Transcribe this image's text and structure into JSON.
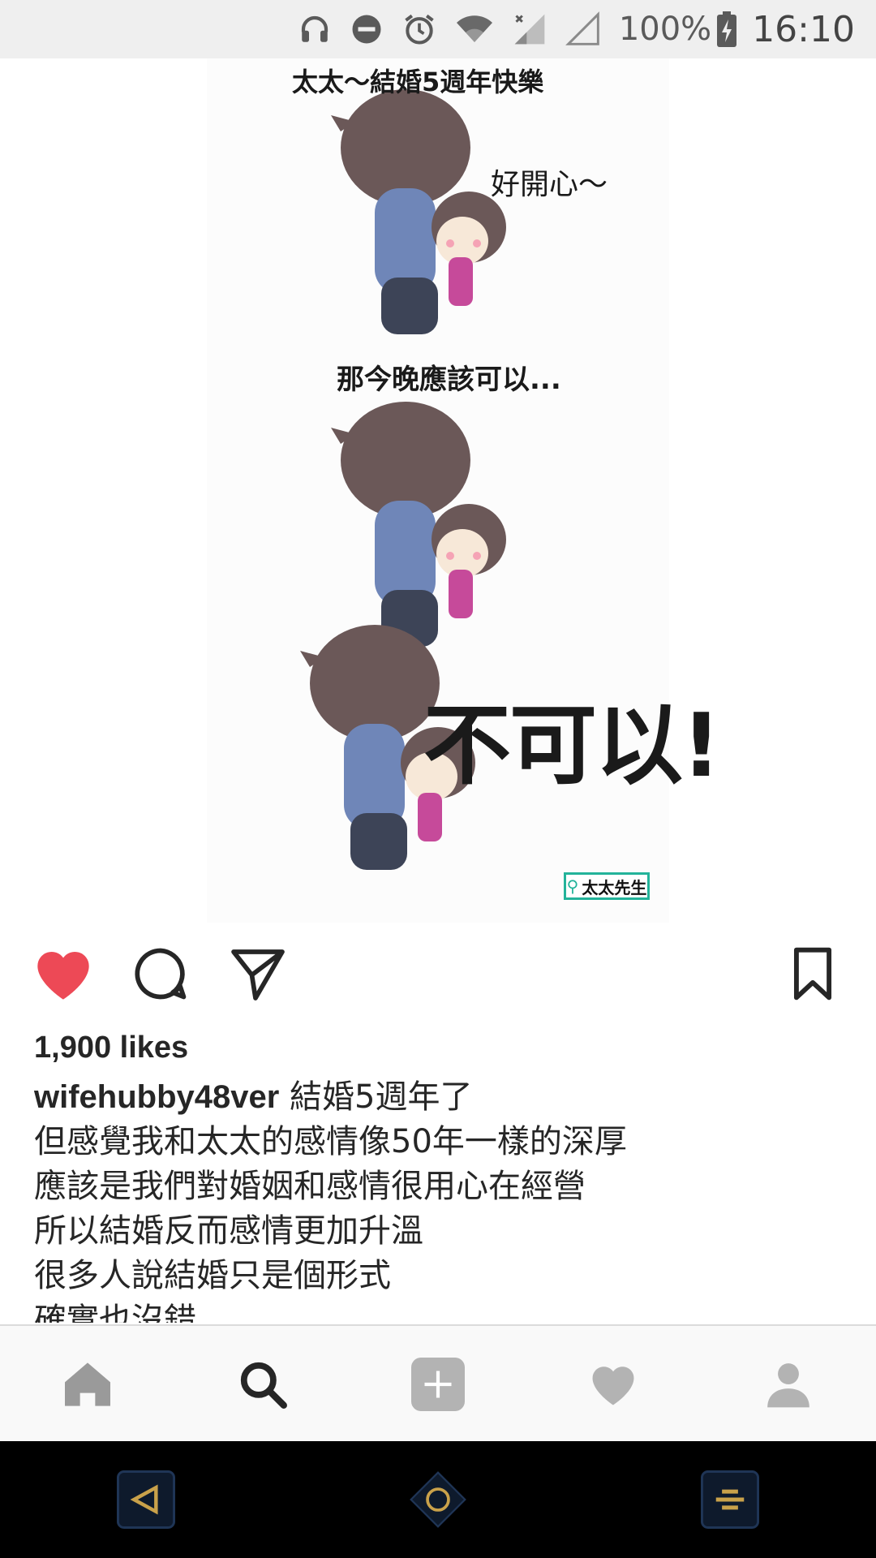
{
  "status_bar": {
    "battery_text": "100%",
    "time": "16:10",
    "icons": [
      "headphones-icon",
      "do-not-disturb-icon",
      "alarm-icon",
      "wifi-icon",
      "signal-icon",
      "no-signal-icon",
      "battery-charging-icon"
    ]
  },
  "post": {
    "image": {
      "panel1_title": "太太～結婚5週年快樂",
      "panel1_speech": "好開心～",
      "panel2_title": "那今晚應該可以...",
      "panel3_speech": "不可以!",
      "watermark": "太太先生"
    },
    "actions": [
      "like-heart-icon",
      "comment-icon",
      "share-send-icon",
      "bookmark-icon"
    ],
    "liked": true,
    "like_color": "#ed4956",
    "likes_text": "1,900 likes",
    "caption": {
      "username": "wifehubby48ver",
      "first_line": "結婚5週年了",
      "lines": [
        "但感覺我和太太的感情像50年一樣的深厚",
        "應該是我們對婚姻和感情很用心在經營",
        "所以結婚反而感情更加升溫",
        "很多人說結婚只是個形式",
        "確實也沒錯"
      ]
    }
  },
  "bottom_nav": {
    "items": [
      "home-icon",
      "search-icon",
      "add-post-icon",
      "activity-heart-icon",
      "profile-icon"
    ],
    "active": "search-icon"
  },
  "system_nav": {
    "items": [
      "back-icon",
      "home-icon",
      "recents-icon"
    ],
    "accent": "#c9a14a"
  }
}
